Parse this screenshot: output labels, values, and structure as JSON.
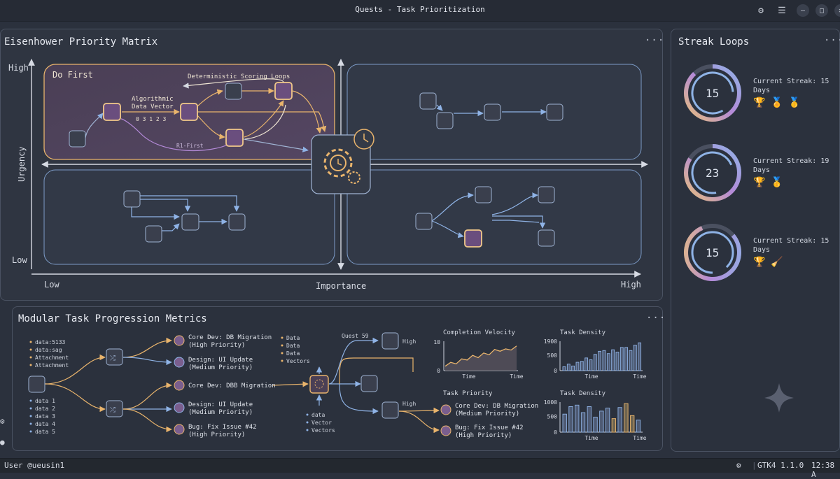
{
  "window": {
    "title": "Quests - Task Prioritization",
    "min": "–",
    "max": "□",
    "close": "✕"
  },
  "matrix": {
    "title": "Eisenhower Priority Matrix",
    "menu": "···",
    "y_axis": "Urgency",
    "y_high": "High",
    "y_low": "Low",
    "x_axis": "Importance",
    "x_low": "Low",
    "x_high": "High",
    "q1_title": "Do First",
    "q1_loops": "Deterministic Scoring Loops",
    "q1_vec1": "Algorithmic",
    "q1_vec2": "Data Vector",
    "q1_nums": "0 3 1 2 3",
    "q1_r1": "R1-First"
  },
  "streaks": {
    "title": "Streak Loops",
    "menu": "···",
    "items": [
      {
        "value": "15",
        "label1": "Current Streak: 15",
        "label2": "Days",
        "badges": [
          "🏆",
          "🏅",
          "🥇"
        ]
      },
      {
        "value": "23",
        "label1": "Current Streak: 19",
        "label2": "Days",
        "badges": [
          "🏆",
          "🥇"
        ]
      },
      {
        "value": "15",
        "label1": "Current Streak: 15",
        "label2": "Days",
        "badges": [
          "🏆",
          "🧹"
        ]
      }
    ]
  },
  "metrics": {
    "title": "Modular Task Progression Metrics",
    "menu": "···",
    "top_inputs": [
      "data:5133",
      "data:sag",
      "Attachment",
      "Attachment"
    ],
    "bottom_inputs": [
      "data 1",
      "data 2",
      "data 3",
      "data 4",
      "data 5"
    ],
    "tasks": [
      {
        "l1": "Core Dev: DB Migration",
        "l2": "(High Priority)"
      },
      {
        "l1": "Design: UI Update",
        "l2": "(Medium Priority)"
      },
      {
        "l1": "Core Dev: DBB Migration",
        "l2": ""
      },
      {
        "l1": "Design: UI Update",
        "l2": "(Medium Priority)"
      },
      {
        "l1": "Bug: Fix Issue #42",
        "l2": "(High Priority)"
      }
    ],
    "mid_inputs": [
      "Data",
      "Data",
      "Data",
      "Vectors"
    ],
    "mid_bottom": [
      "data",
      "Vector",
      "Vectors"
    ],
    "quest": "Quest 59",
    "high_top": "High",
    "high_bottom": "High",
    "priority_title": "Task Priority",
    "priority_items": [
      {
        "l1": "Core Dev: DB Migration",
        "l2": "(Medium Priority)"
      },
      {
        "l1": "Bug: Fix Issue #42",
        "l2": "(High Priority)"
      }
    ]
  },
  "chart_data": [
    {
      "type": "area",
      "title": "Completion Velocity",
      "xlabel": "Time",
      "ylim": [
        0,
        10
      ],
      "yticks": [
        "10",
        "0"
      ],
      "xticks": [
        "Time",
        "Time"
      ],
      "values": [
        1.5,
        2.8,
        2.3,
        4.0,
        3.6,
        5.2,
        4.4,
        6.0,
        5.4,
        7.2,
        6.6,
        7.4,
        7.0,
        8.4
      ]
    },
    {
      "type": "bar",
      "title": "Task Density",
      "ylim": [
        0,
        1900
      ],
      "yticks": [
        "1900",
        "500",
        "0"
      ],
      "xticks": [
        "Time",
        "Time"
      ],
      "values": [
        250,
        420,
        300,
        540,
        600,
        820,
        700,
        1050,
        1250,
        1300,
        1100,
        1350,
        1200,
        1500,
        1500,
        1300,
        1650,
        1800
      ]
    },
    {
      "type": "bar",
      "title": "Task Density",
      "ylim": [
        0,
        1000
      ],
      "yticks": [
        "1000",
        "500",
        "0"
      ],
      "xticks": [
        "Time",
        "Time"
      ],
      "values": [
        600,
        850,
        900,
        650,
        850,
        500,
        700,
        800,
        450,
        820,
        950,
        550,
        400
      ],
      "highlighted": [
        8,
        10,
        11
      ]
    }
  ],
  "status": {
    "user": "User @ueusin1",
    "version": "GTK4 1.1.0",
    "clock": "12:38 A"
  },
  "colors": {
    "accent_orange": "#e9b46c",
    "accent_purple": "#b48ad8",
    "accent_blue": "#8fb3e6",
    "node_bg": "#3a3f4d"
  }
}
